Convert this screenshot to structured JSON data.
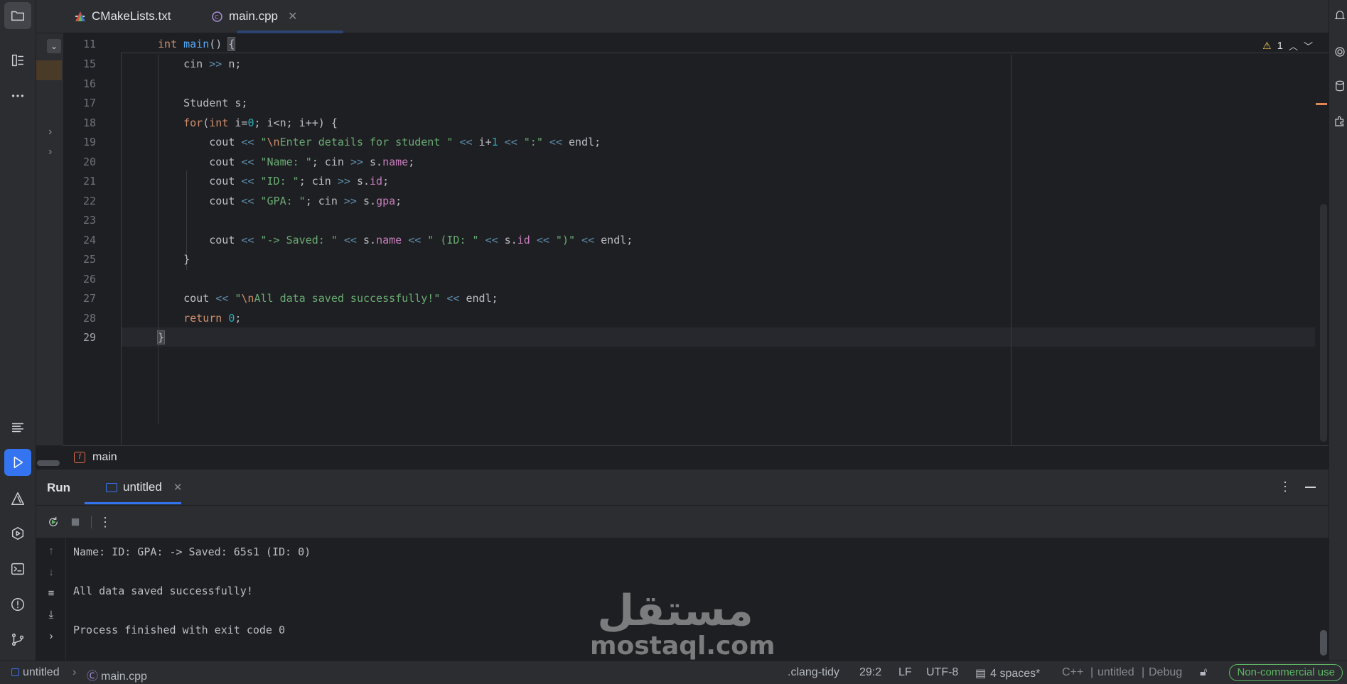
{
  "tabs": [
    {
      "label": "CMakeLists.txt",
      "active": false
    },
    {
      "label": "main.cpp",
      "active": true
    }
  ],
  "editor": {
    "warning_count": "1",
    "sticky_line": {
      "num": "11"
    },
    "lines": [
      {
        "num": "15"
      },
      {
        "num": "16"
      },
      {
        "num": "17"
      },
      {
        "num": "18"
      },
      {
        "num": "19"
      },
      {
        "num": "20"
      },
      {
        "num": "21"
      },
      {
        "num": "22"
      },
      {
        "num": "23"
      },
      {
        "num": "24"
      },
      {
        "num": "25"
      },
      {
        "num": "26"
      },
      {
        "num": "27"
      },
      {
        "num": "28"
      },
      {
        "num": "29"
      }
    ],
    "code": {
      "l11_kw": "int",
      "l11_fn": "main",
      "l11_rest": "() ",
      "l11_brace": "{",
      "l15_a": "    cin ",
      "l15_op": ">>",
      "l15_b": " n;",
      "l17": "    Student s;",
      "l18_kw1": "for",
      "l18_p": "(",
      "l18_kw2": "int",
      "l18_a": " i=",
      "l18_n": "0",
      "l18_b": "; i<n; i++) {",
      "l19_a": "        cout ",
      "l19_op1": "<<",
      "l19_s1": " \"",
      "l19_esc": "\\n",
      "l19_s2": "Enter details for student \"",
      "l19_op2": " <<",
      "l19_b": " i+",
      "l19_n": "1",
      "l19_op3": " <<",
      "l19_s3": " \":\"",
      "l19_op4": " <<",
      "l19_c": " endl;",
      "l20_a": "        cout ",
      "l20_op1": "<<",
      "l20_s": " \"Name: \"",
      "l20_b": "; cin ",
      "l20_op2": ">>",
      "l20_c": " s.",
      "l20_f": "name",
      "l20_d": ";",
      "l21_a": "        cout ",
      "l21_op1": "<<",
      "l21_s": " \"ID: \"",
      "l21_b": "; cin ",
      "l21_op2": ">>",
      "l21_c": " s.",
      "l21_f": "id",
      "l21_d": ";",
      "l22_a": "        cout ",
      "l22_op1": "<<",
      "l22_s": " \"GPA: \"",
      "l22_b": "; cin ",
      "l22_op2": ">>",
      "l22_c": " s.",
      "l22_f": "gpa",
      "l22_d": ";",
      "l24_a": "        cout ",
      "l24_op1": "<<",
      "l24_s1": " \"-> Saved: \"",
      "l24_op2": " <<",
      "l24_b": " s.",
      "l24_f1": "name",
      "l24_op3": " <<",
      "l24_s2": " \" (ID: \"",
      "l24_op4": " <<",
      "l24_c": " s.",
      "l24_f2": "id",
      "l24_op5": " <<",
      "l24_s3": " \")\"",
      "l24_op6": " <<",
      "l24_d": " endl;",
      "l25": "    }",
      "l27_a": "    cout ",
      "l27_op1": "<<",
      "l27_s1": " \"",
      "l27_esc": "\\n",
      "l27_s2": "All data saved successfully!\"",
      "l27_op2": " <<",
      "l27_b": " endl;",
      "l28_kw": "return",
      "l28_n": "0",
      "l28_b": ";",
      "l29": "}"
    }
  },
  "breadcrumb": {
    "function": "main",
    "badge": "f"
  },
  "run_panel": {
    "title": "Run",
    "tab_label": "untitled",
    "output": [
      "Name: ID: GPA: -> Saved: 65s1 (ID: 0)",
      "",
      "All data saved successfully!",
      "",
      "Process finished with exit code 0"
    ]
  },
  "watermark": {
    "arabic": "مستقل",
    "latin": "mostaql.com"
  },
  "statusbar": {
    "project": "untitled",
    "file": "main.cpp",
    "linter": ".clang-tidy",
    "position": "29:2",
    "line_sep": "LF",
    "encoding": "UTF-8",
    "indent": "4 spaces*",
    "language": "C++",
    "config_project": "untitled",
    "config_build": "Debug",
    "license": "Non-commercial use"
  },
  "colors": {
    "accent": "#3574f0",
    "keyword": "#cf8e6d",
    "string": "#6aab73",
    "number": "#2aacb8",
    "function": "#56a8f5",
    "field": "#c77dbb",
    "license": "#5fb865"
  }
}
